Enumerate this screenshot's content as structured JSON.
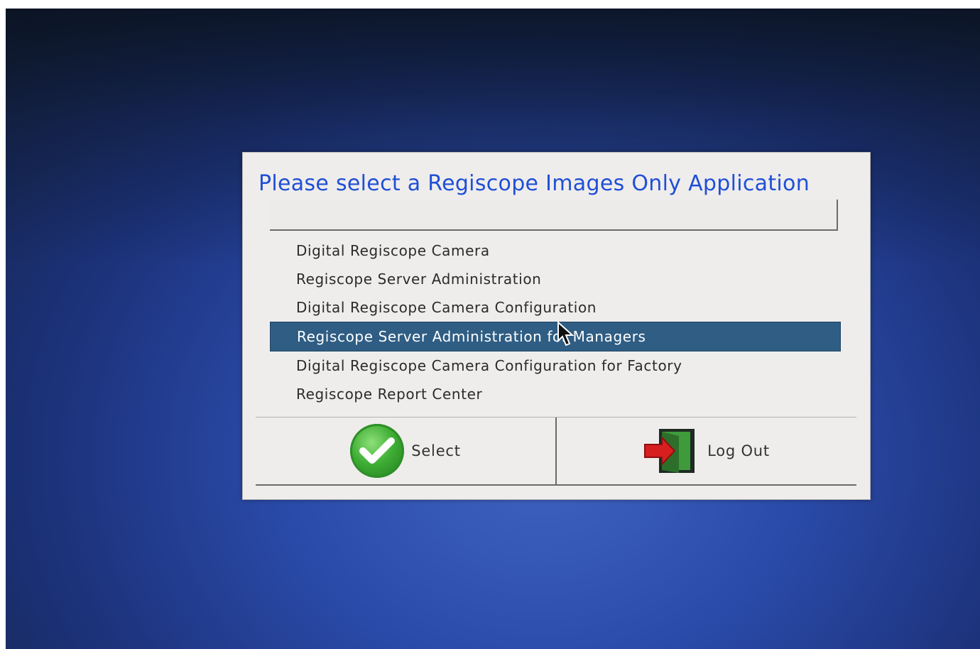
{
  "dialog": {
    "title": "Please select a Regiscope Images Only Application",
    "filter_value": "",
    "applications": [
      "Digital Regiscope Camera",
      "Regiscope Server Administration",
      "Digital Regiscope Camera Configuration",
      "Regiscope Server Administration for Managers",
      "Digital Regiscope Camera Configuration for Factory",
      "Regiscope Report Center"
    ],
    "selected_index": 3,
    "buttons": {
      "select_label": "Select",
      "select_icon": "green-checkmark-icon",
      "logout_label": "Log Out",
      "logout_icon": "exit-door-icon"
    }
  },
  "colors": {
    "title": "#1f4fd6",
    "selection": "#2f5d83",
    "dialog_bg": "#efedec"
  }
}
